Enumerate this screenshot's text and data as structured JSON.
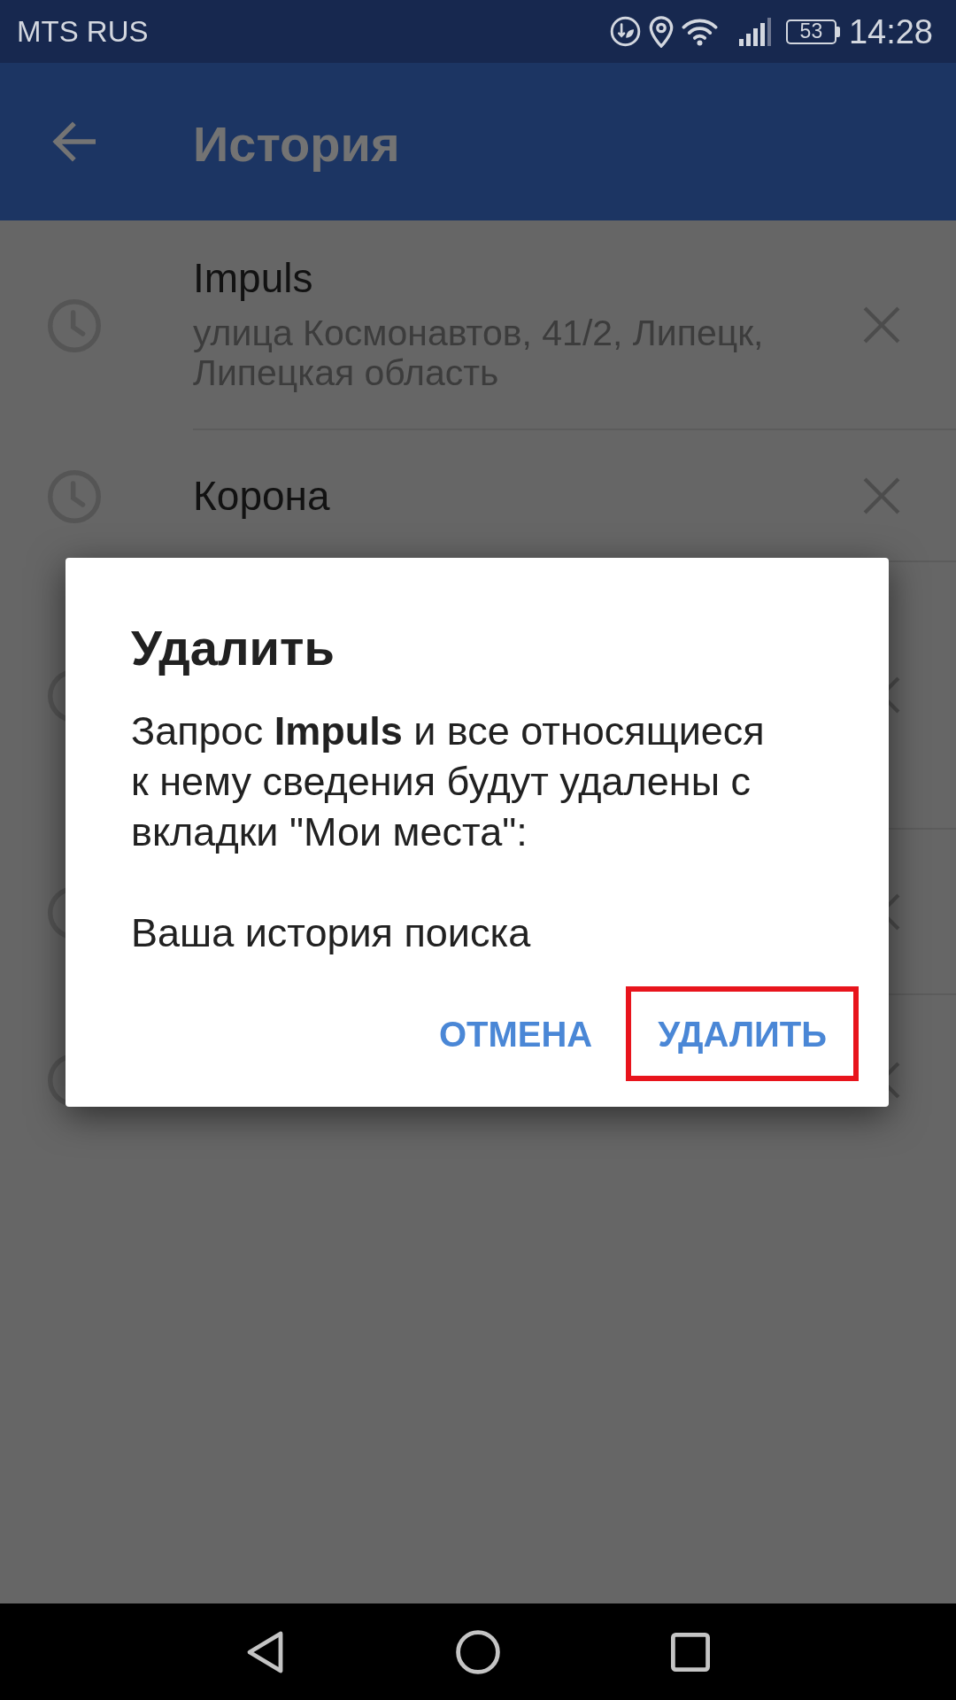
{
  "status_bar": {
    "carrier": "MTS RUS",
    "battery": "53",
    "time": "14:28"
  },
  "app_bar": {
    "title": "История"
  },
  "history": [
    {
      "title": "Impuls",
      "subtitle": "улица Космонавтов, 41/2, Липецк, Липецкая область"
    },
    {
      "title": "Корона"
    }
  ],
  "dialog": {
    "title": "Удалить",
    "message": "Запрос **Impuls** и все относящиеся к нему сведения будут удалены с вкладки \"Мои места\":",
    "detail": "Ваша история поиска",
    "buttons": [
      {
        "label": "ОТМЕНА",
        "highlighted": false
      },
      {
        "label": "УДАЛИТЬ",
        "highlighted": true
      }
    ]
  }
}
